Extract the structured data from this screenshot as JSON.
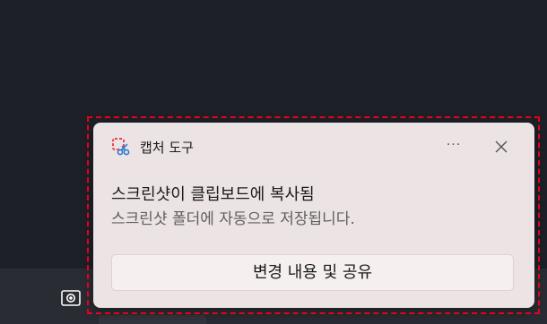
{
  "toast": {
    "app_name": "캡처 도구",
    "more_label": "···",
    "title": "스크린샷이 클립보드에 복사됨",
    "body": "스크린샷 폴더에 자동으로 저장됩니다.",
    "action_label": "변경 내용 및 공유"
  },
  "icons": {
    "app": "snipping-tool-icon",
    "more": "more-options-icon",
    "close": "close-icon",
    "taskbar": "screen-capture-icon"
  },
  "colors": {
    "outline": "#e8001c",
    "toast_bg": "#ece3e4",
    "button_bg": "#f5efef",
    "taskbar_bg": "#2a2c33",
    "desktop_bg": "#1e2028"
  }
}
